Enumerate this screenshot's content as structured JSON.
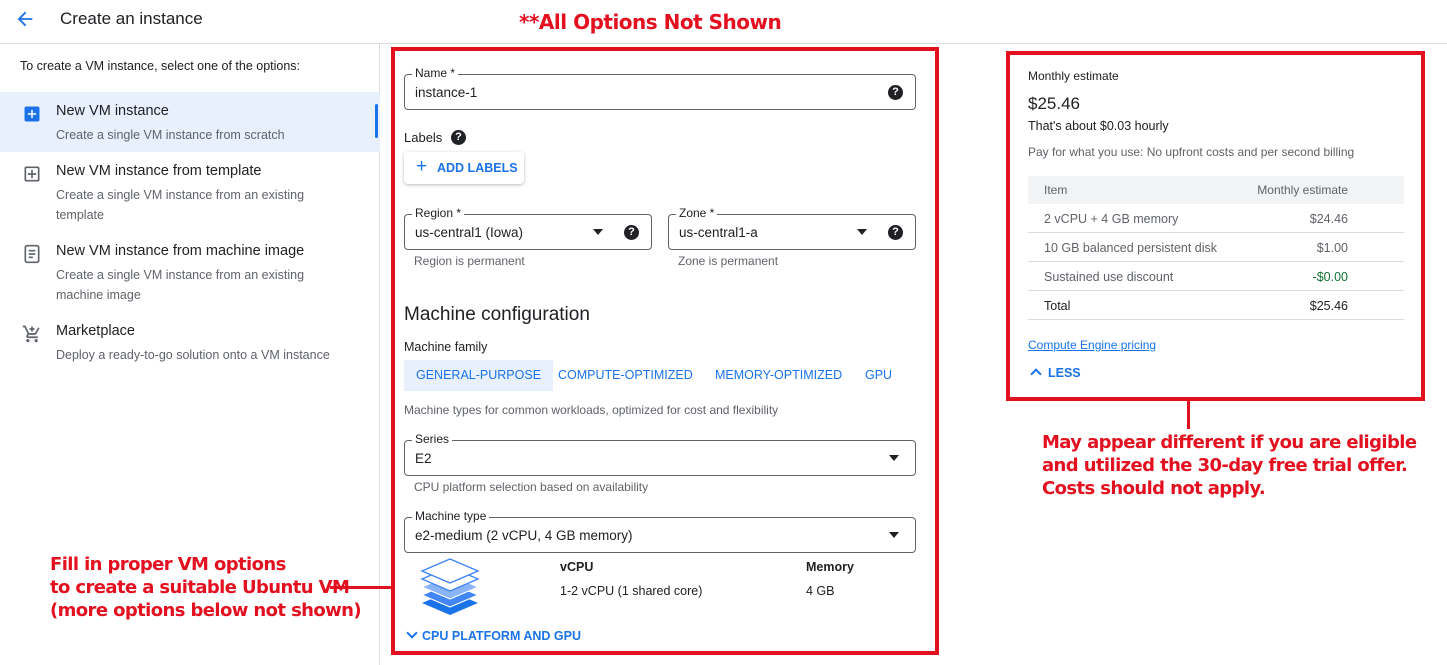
{
  "header": {
    "title": "Create an instance",
    "back_icon": "arrow-back-icon"
  },
  "annotations": {
    "top": "**All Options Not Shown",
    "left": [
      "Fill in proper VM options",
      "to create a suitable Ubuntu VM",
      "(more options below not shown)"
    ],
    "right": [
      "May appear different if you are eligible",
      "and utilized the 30-day free trial offer.",
      "Costs should not apply."
    ],
    "color": "#e3101f"
  },
  "sidebar": {
    "intro": "To create a VM instance, select one of the options:",
    "items": [
      {
        "icon": "add-box-icon",
        "title": "New VM instance",
        "desc": "Create a single VM instance from scratch",
        "selected": true
      },
      {
        "icon": "template-icon",
        "title": "New VM instance from template",
        "desc": "Create a single VM instance from an existing template",
        "selected": false
      },
      {
        "icon": "machine-image-icon",
        "title": "New VM instance from machine image",
        "desc": "Create a single VM instance from an existing machine image",
        "selected": false
      },
      {
        "icon": "cart-icon",
        "title": "Marketplace",
        "desc": "Deploy a ready-to-go solution onto a VM instance",
        "selected": false
      }
    ]
  },
  "form": {
    "name": {
      "label": "Name *",
      "value": "instance-1"
    },
    "labels": {
      "title": "Labels",
      "add_button": "ADD LABELS"
    },
    "region": {
      "label": "Region *",
      "value": "us-central1 (Iowa)",
      "hint": "Region is permanent"
    },
    "zone": {
      "label": "Zone *",
      "value": "us-central1-a",
      "hint": "Zone is permanent"
    },
    "machine_config": {
      "title": "Machine configuration",
      "family_label": "Machine family",
      "tabs": [
        "GENERAL-PURPOSE",
        "COMPUTE-OPTIMIZED",
        "MEMORY-OPTIMIZED",
        "GPU"
      ],
      "active_tab": "GENERAL-PURPOSE",
      "family_desc": "Machine types for common workloads, optimized for cost and flexibility",
      "series": {
        "label": "Series",
        "value": "E2",
        "hint": "CPU platform selection based on availability"
      },
      "machine_type": {
        "label": "Machine type",
        "value": "e2-medium (2 vCPU, 4 GB memory)"
      },
      "specs": {
        "vcpu_header": "vCPU",
        "vcpu_value": "1-2 vCPU (1 shared core)",
        "memory_header": "Memory",
        "memory_value": "4 GB"
      },
      "cpu_platform_link": "CPU PLATFORM AND GPU"
    }
  },
  "estimate": {
    "title": "Monthly estimate",
    "amount": "$25.46",
    "hourly": "That's about $0.03 hourly",
    "note": "Pay for what you use: No upfront costs and per second billing",
    "table": {
      "headers": [
        "Item",
        "Monthly estimate"
      ],
      "rows": [
        [
          "2 vCPU + 4 GB memory",
          "$24.46"
        ],
        [
          "10 GB balanced persistent disk",
          "$1.00"
        ],
        [
          "Sustained use discount",
          "-$0.00"
        ]
      ],
      "total": [
        "Total",
        "$25.46"
      ]
    },
    "pricing_link": "Compute Engine pricing",
    "less_button": "LESS"
  }
}
